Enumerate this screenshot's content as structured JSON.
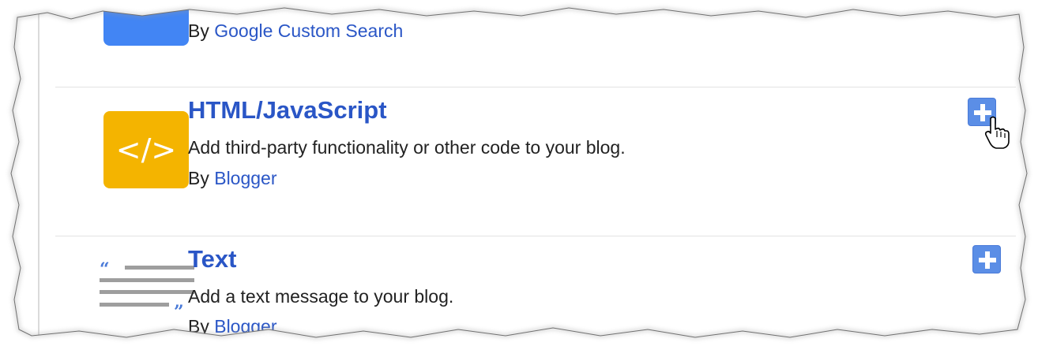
{
  "colors": {
    "link": "#2a56c6",
    "text": "#222222",
    "add_button": "#5b8ee6",
    "html_icon_bg": "#f4b400",
    "search_icon_bg": "#4285f4",
    "text_icon_gray": "#9e9e9e",
    "text_icon_quote": "#4a7ad8",
    "divider": "#e2e2e2"
  },
  "gadgets": [
    {
      "icon": "search-icon",
      "author_prefix": "By",
      "author": "Google Custom Search"
    },
    {
      "icon": "code-icon",
      "icon_glyph": "</>",
      "title": "HTML/JavaScript",
      "description": "Add third-party functionality or other code to your blog.",
      "author_prefix": "By",
      "author": "Blogger",
      "add_button_icon": "plus-icon",
      "cursor": "hand-pointer-icon"
    },
    {
      "icon": "text-document-icon",
      "title": "Text",
      "description": "Add a text message to your blog.",
      "author_prefix": "By",
      "author": "Blogger",
      "add_button_icon": "plus-icon"
    }
  ]
}
